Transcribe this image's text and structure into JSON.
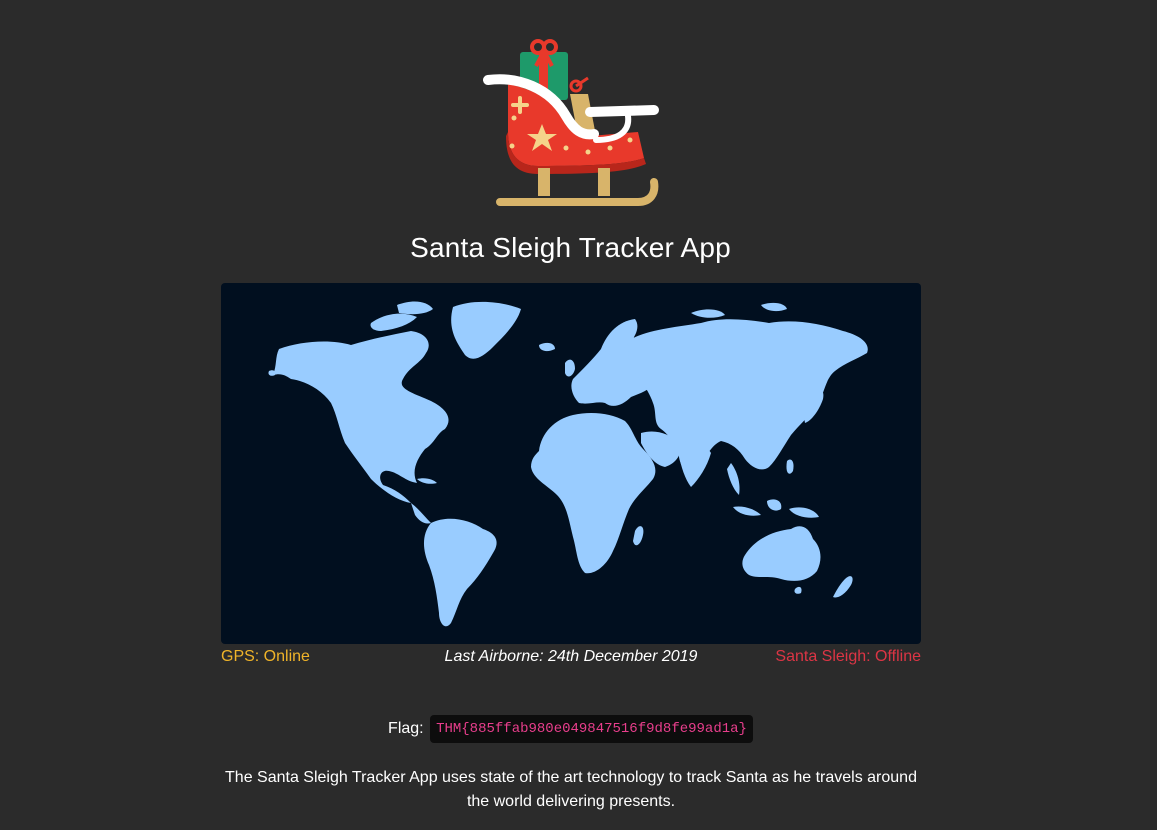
{
  "page": {
    "title": "Santa Sleigh Tracker App",
    "logo_icon": "sleigh-icon",
    "map_icon": "world-map"
  },
  "status": {
    "gps": "GPS: Online",
    "last_airborne": "Last Airborne: 24th December 2019",
    "sleigh": "Santa Sleigh: Offline"
  },
  "flag": {
    "label": "Flag:",
    "value": "THM{885ffab980e049847516f9d8fe99ad1a}"
  },
  "description": "The Santa Sleigh Tracker App uses state of the art technology to track Santa as he travels around the world delivering presents.",
  "colors": {
    "background": "#2b2b2b",
    "map_background": "#010f1f",
    "land": "#99ccff",
    "gps_online": "#f0b429",
    "sleigh_offline": "#dc3545",
    "flag_text": "#e83e8c"
  }
}
